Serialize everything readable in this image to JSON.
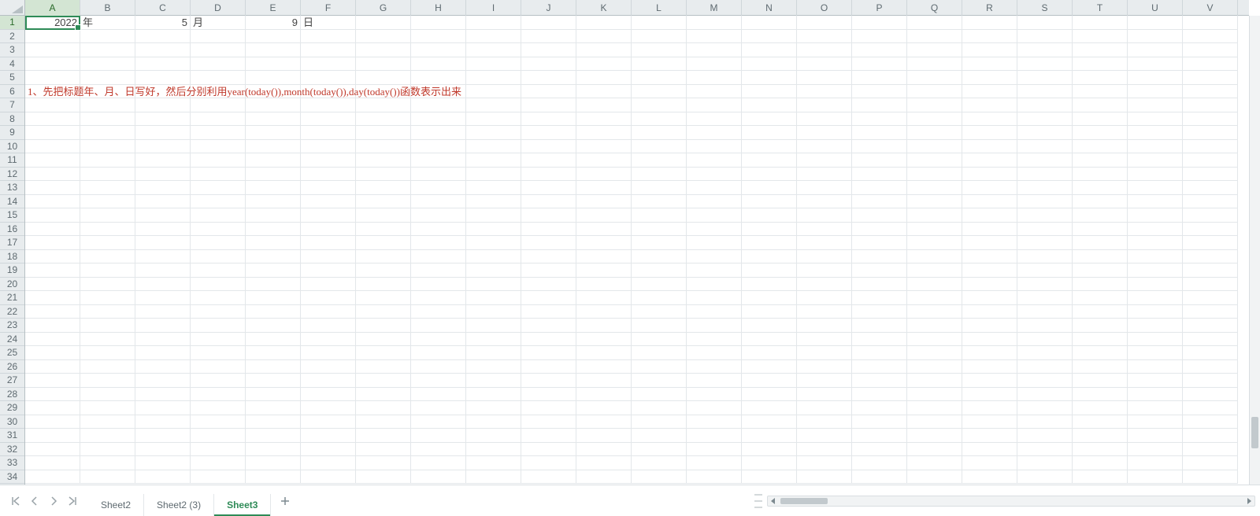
{
  "columns": [
    "A",
    "B",
    "C",
    "D",
    "E",
    "F",
    "G",
    "H",
    "I",
    "J",
    "K",
    "L",
    "M",
    "N",
    "O",
    "P",
    "Q",
    "R",
    "S",
    "T",
    "U",
    "V"
  ],
  "row_count": 34,
  "active_cell": {
    "col": "A",
    "row": 1
  },
  "cells": {
    "A1": "2022",
    "B1": "年",
    "C1": "5",
    "D1": "月",
    "E1": "9",
    "F1": "日",
    "A6": "1、先把标题年、月、日写好，然后分别利用year(today()),month(today()),day(today())函数表示出来"
  },
  "cell_styles": {
    "A1": "right",
    "B1": "left",
    "C1": "right",
    "D1": "left",
    "E1": "right",
    "F1": "left",
    "A6": "red"
  },
  "tabs": [
    {
      "label": "Sheet2",
      "active": false
    },
    {
      "label": "Sheet2 (3)",
      "active": false
    },
    {
      "label": "Sheet3",
      "active": true
    }
  ]
}
